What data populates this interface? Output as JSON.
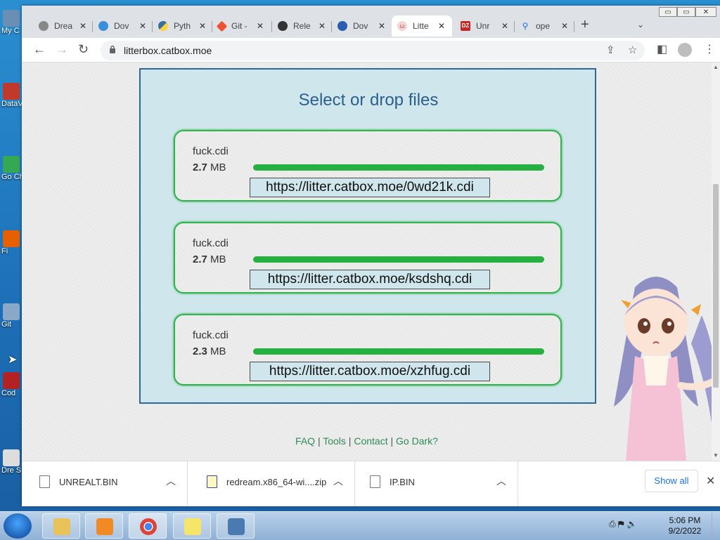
{
  "desktop": {
    "icons": [
      {
        "label": "My C"
      },
      {
        "label": "DataV"
      },
      {
        "label": "Go Ch"
      },
      {
        "label": "Fi"
      },
      {
        "label": "Git"
      },
      {
        "label": "Cod"
      },
      {
        "label": "Dre S"
      }
    ]
  },
  "window": {
    "controls": {
      "minimize": "▭",
      "restore": "▭",
      "close": "✕"
    }
  },
  "tabs": [
    {
      "title": "Drea"
    },
    {
      "title": "Dov"
    },
    {
      "title": "Pyth"
    },
    {
      "title": "Git -"
    },
    {
      "title": "Rele"
    },
    {
      "title": "Dov"
    },
    {
      "title": "Litte",
      "active": true
    },
    {
      "title": "Unr"
    },
    {
      "title": "ope"
    }
  ],
  "address": {
    "url": "litterbox.catbox.moe"
  },
  "page": {
    "heading": "Select or drop files",
    "files": [
      {
        "name": "fuck.cdi",
        "size_value": "2.7",
        "size_unit": "MB",
        "progress": 1.0,
        "link": "https://litter.catbox.moe/0wd21k.cdi"
      },
      {
        "name": "fuck.cdi",
        "size_value": "2.7",
        "size_unit": "MB",
        "progress": 1.0,
        "link": "https://litter.catbox.moe/ksdshq.cdi"
      },
      {
        "name": "fuck.cdi",
        "size_value": "2.3",
        "size_unit": "MB",
        "progress": 1.0,
        "link": "https://litter.catbox.moe/xzhfug.cdi"
      }
    ],
    "footer": {
      "faq": "FAQ",
      "tools": "Tools",
      "contact": "Contact",
      "dark": "Go Dark?",
      "sep": " | "
    }
  },
  "downloads": {
    "items": [
      {
        "name": "UNREALT.BIN"
      },
      {
        "name": "redream.x86_64-wi....zip"
      },
      {
        "name": "IP.BIN"
      }
    ],
    "show_all": "Show all"
  },
  "taskbar": {
    "time": "5:06 PM",
    "date": "9/2/2022"
  },
  "colors": {
    "accent_green": "#25b040",
    "panel_bg": "#cfe6ec",
    "panel_border": "#2a6a94",
    "heading": "#2b5f8e"
  }
}
